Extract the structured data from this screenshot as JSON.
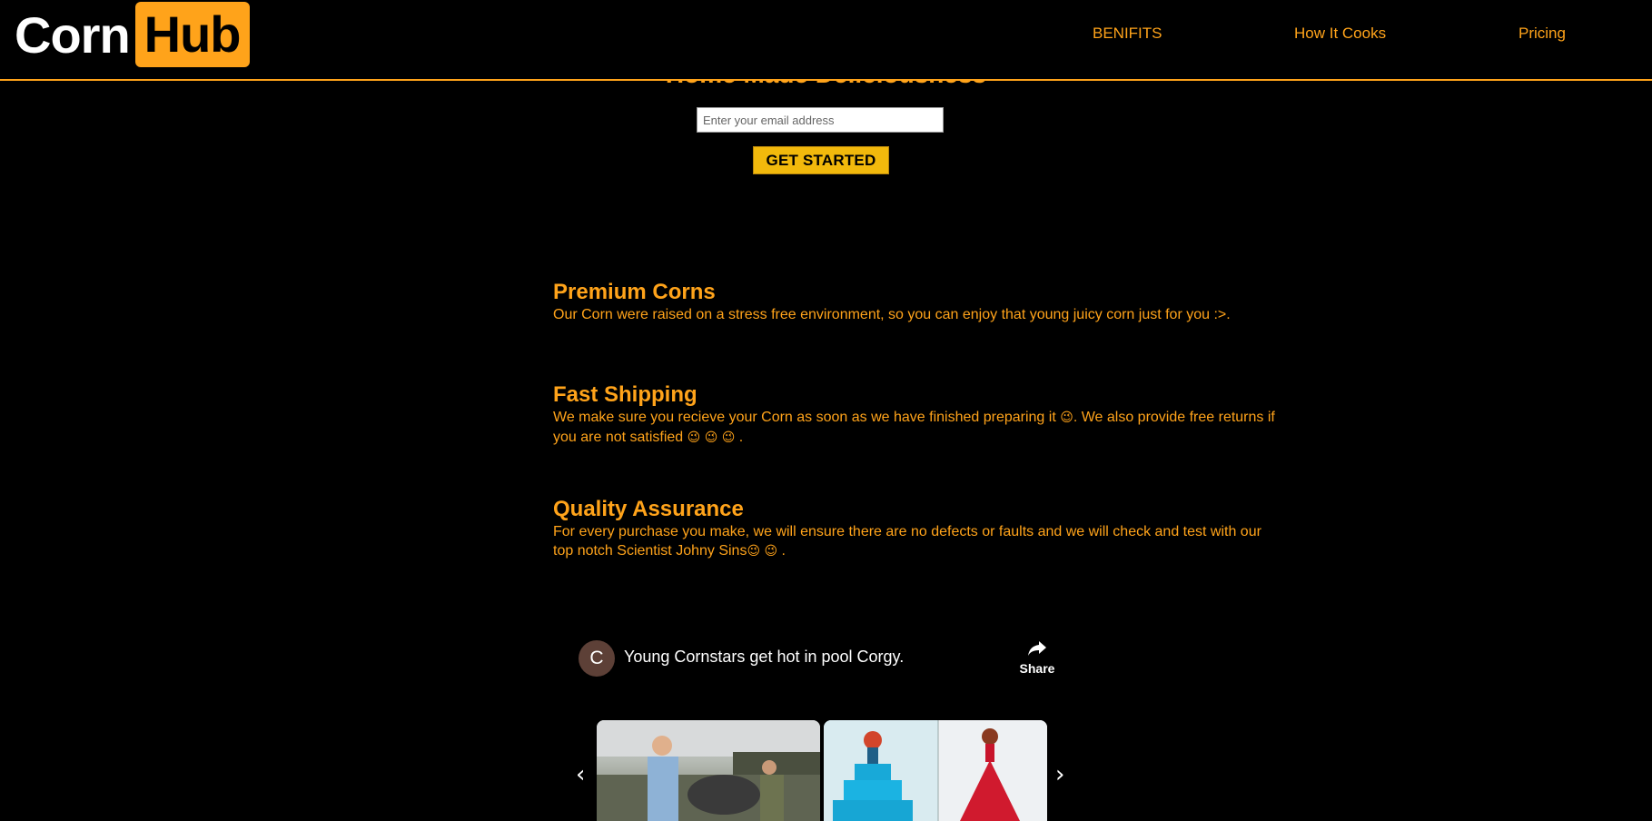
{
  "header": {
    "logo_left": "Corn",
    "logo_right": "Hub",
    "nav": [
      "BENIFITS",
      "How It Cooks",
      "Pricing"
    ]
  },
  "hero": {
    "title": "Home Made Deliciousness",
    "email_placeholder": "Enter your email address",
    "cta": "GET STARTED"
  },
  "features": [
    {
      "title": "Premium Corns",
      "text": "Our Corn were raised on a stress free environment, so you can enjoy that young juicy corn just for you :>."
    },
    {
      "title": "Fast Shipping",
      "text_a": "We make sure you recieve your Corn as soon as we have finished preparing it",
      "emoji_a": "😉",
      "text_b": ". We also provide free returns if you are not satisfied",
      "emoji_b": "😉 😉 😉",
      "text_c": "."
    },
    {
      "title": "Quality Assurance",
      "text_a": "For every purchase you make, we will ensure there are no defects or faults and we will check and test with our top notch Scientist Johny Sins",
      "emoji_a": "😉 😉",
      "text_b": "."
    }
  ],
  "video": {
    "avatar_letter": "C",
    "title": "Young Cornstars get hot in pool Corgy.",
    "share_label": "Share"
  },
  "carousel": {
    "prev": "‹",
    "next": "›"
  },
  "colors": {
    "accent": "#ffa31a",
    "background": "#000000",
    "cta": "#f2b90c"
  }
}
